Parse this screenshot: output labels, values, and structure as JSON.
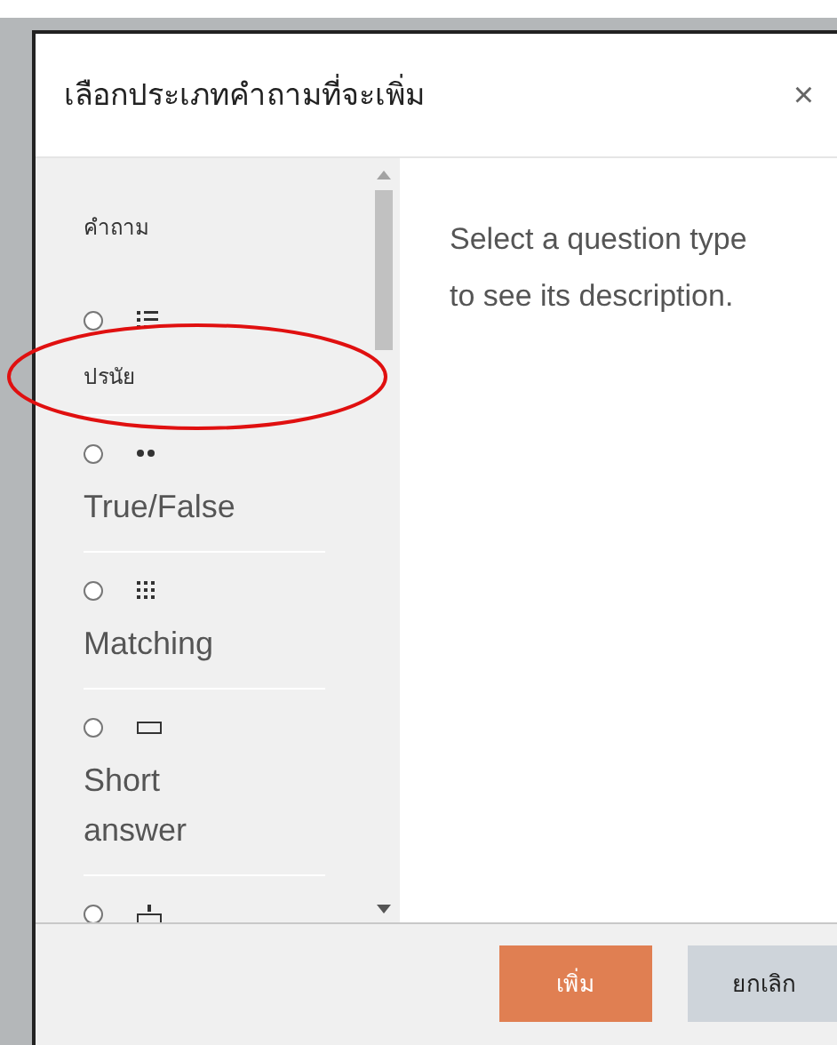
{
  "dialog": {
    "title": "เลือกประเภทคำถามที่จะเพิ่ม",
    "close": "×"
  },
  "question_list": {
    "section": "คำถาม",
    "items": [
      {
        "kind": "multichoice",
        "label": "ปรนัย",
        "selected": false
      },
      {
        "kind": "truefalse",
        "label": "True/False",
        "selected": false
      },
      {
        "kind": "matching",
        "label": "Matching",
        "selected": false
      },
      {
        "kind": "shortanswer",
        "label": "Short answer",
        "selected": false
      },
      {
        "kind": "numerical",
        "selected": false
      }
    ]
  },
  "description": "Select a question type to see its description.",
  "buttons": [
    {
      "kind": "primary",
      "label": "เพิ่ม"
    },
    {
      "kind": "secondary",
      "label": "ยกเลิก"
    }
  ]
}
